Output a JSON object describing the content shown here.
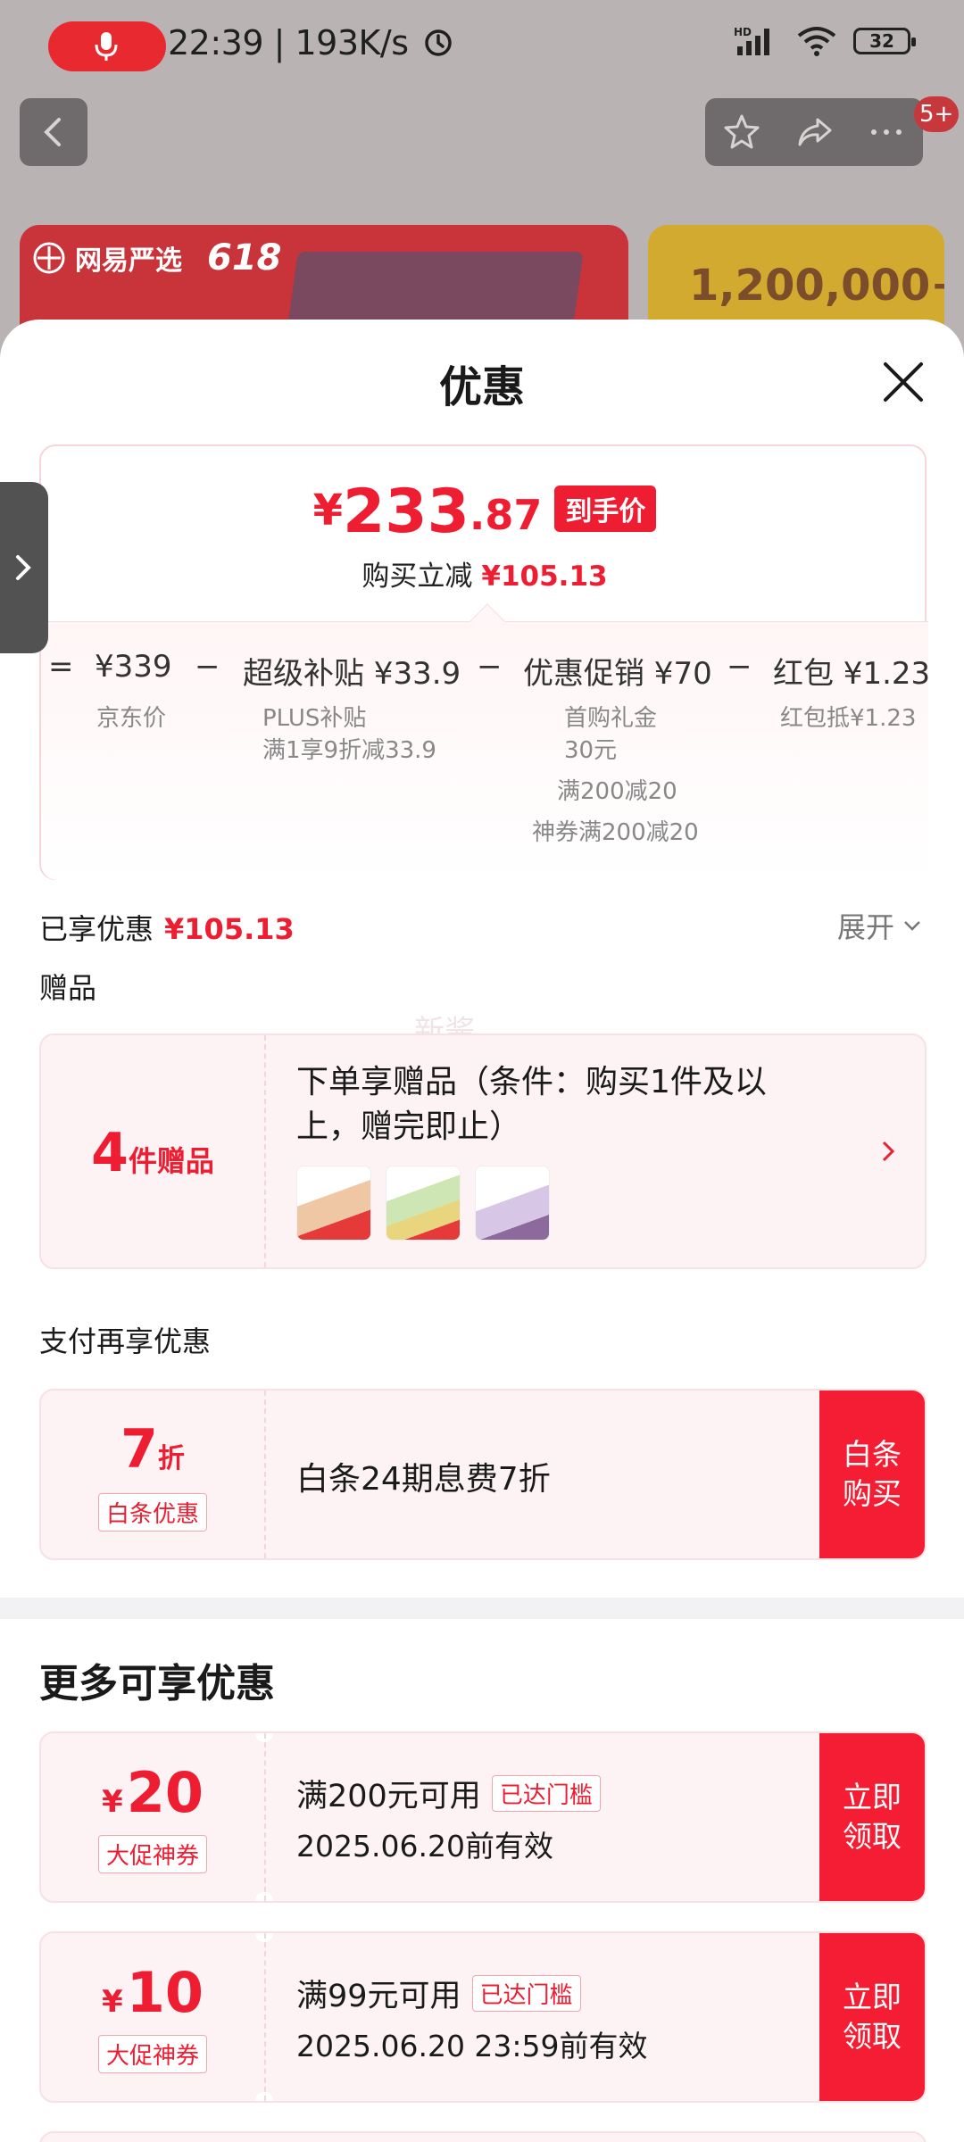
{
  "status_bar": {
    "time_speed": "22:39 | 193K/s",
    "battery": "32",
    "network_label": "HD"
  },
  "nav": {
    "badge": "5+"
  },
  "background_banners": {
    "left_logo": "网易严选",
    "left_tag": "618",
    "right_number": "1,200,000+"
  },
  "sheet": {
    "title": "优惠",
    "price": {
      "symbol": "¥",
      "integer": "233",
      "decimal": ".87",
      "tag": "到手价",
      "subtitle": "购买立减",
      "saving": "¥105.13"
    },
    "breakdown": {
      "items": [
        {
          "op": "=",
          "label": "¥339",
          "subs": [
            "京东价"
          ]
        },
        {
          "op": "−",
          "label": "超级补贴 ¥33.9",
          "subs": [
            "PLUS补贴",
            "满1享9折减33.9"
          ]
        },
        {
          "op": "−",
          "label": "优惠促销 ¥70",
          "subs": [
            "首购礼金",
            "30元",
            "满200减20",
            "神券满200减20"
          ]
        },
        {
          "op": "−",
          "label": "红包 ¥1.23",
          "subs": [
            "红包抵¥1.23"
          ]
        }
      ]
    },
    "enjoyed": {
      "label": "已享优惠",
      "value": "¥105.13",
      "expand": "展开"
    },
    "gifts": {
      "section_label": "赠品",
      "count": "4",
      "count_unit": "件赠品",
      "title": "下单享赠品（条件：购买1件及以上，赠完即止）"
    },
    "watermark": "新酱",
    "pay": {
      "section_label": "支付再享优惠",
      "discount": "7",
      "discount_unit": "折",
      "tag": "白条优惠",
      "text": "白条24期息费7折",
      "cta": "白条\n购买"
    },
    "more": {
      "title": "更多可享优惠",
      "coupons": [
        {
          "symbol": "¥",
          "amount": "20",
          "tag": "大促神券",
          "condition": "满200元可用",
          "status": "已达门槛",
          "validity": "2025.06.20前有效",
          "cta": "立即\n领取"
        },
        {
          "symbol": "¥",
          "amount": "10",
          "tag": "大促神券",
          "condition": "满99元可用",
          "status": "已达门槛",
          "validity": "2025.06.20 23:59前有效",
          "cta": "立即\n领取"
        }
      ]
    }
  },
  "colors": {
    "accent": "#ef1d31",
    "cta": "#f51d33",
    "card_bg": "#fdf3f4"
  }
}
